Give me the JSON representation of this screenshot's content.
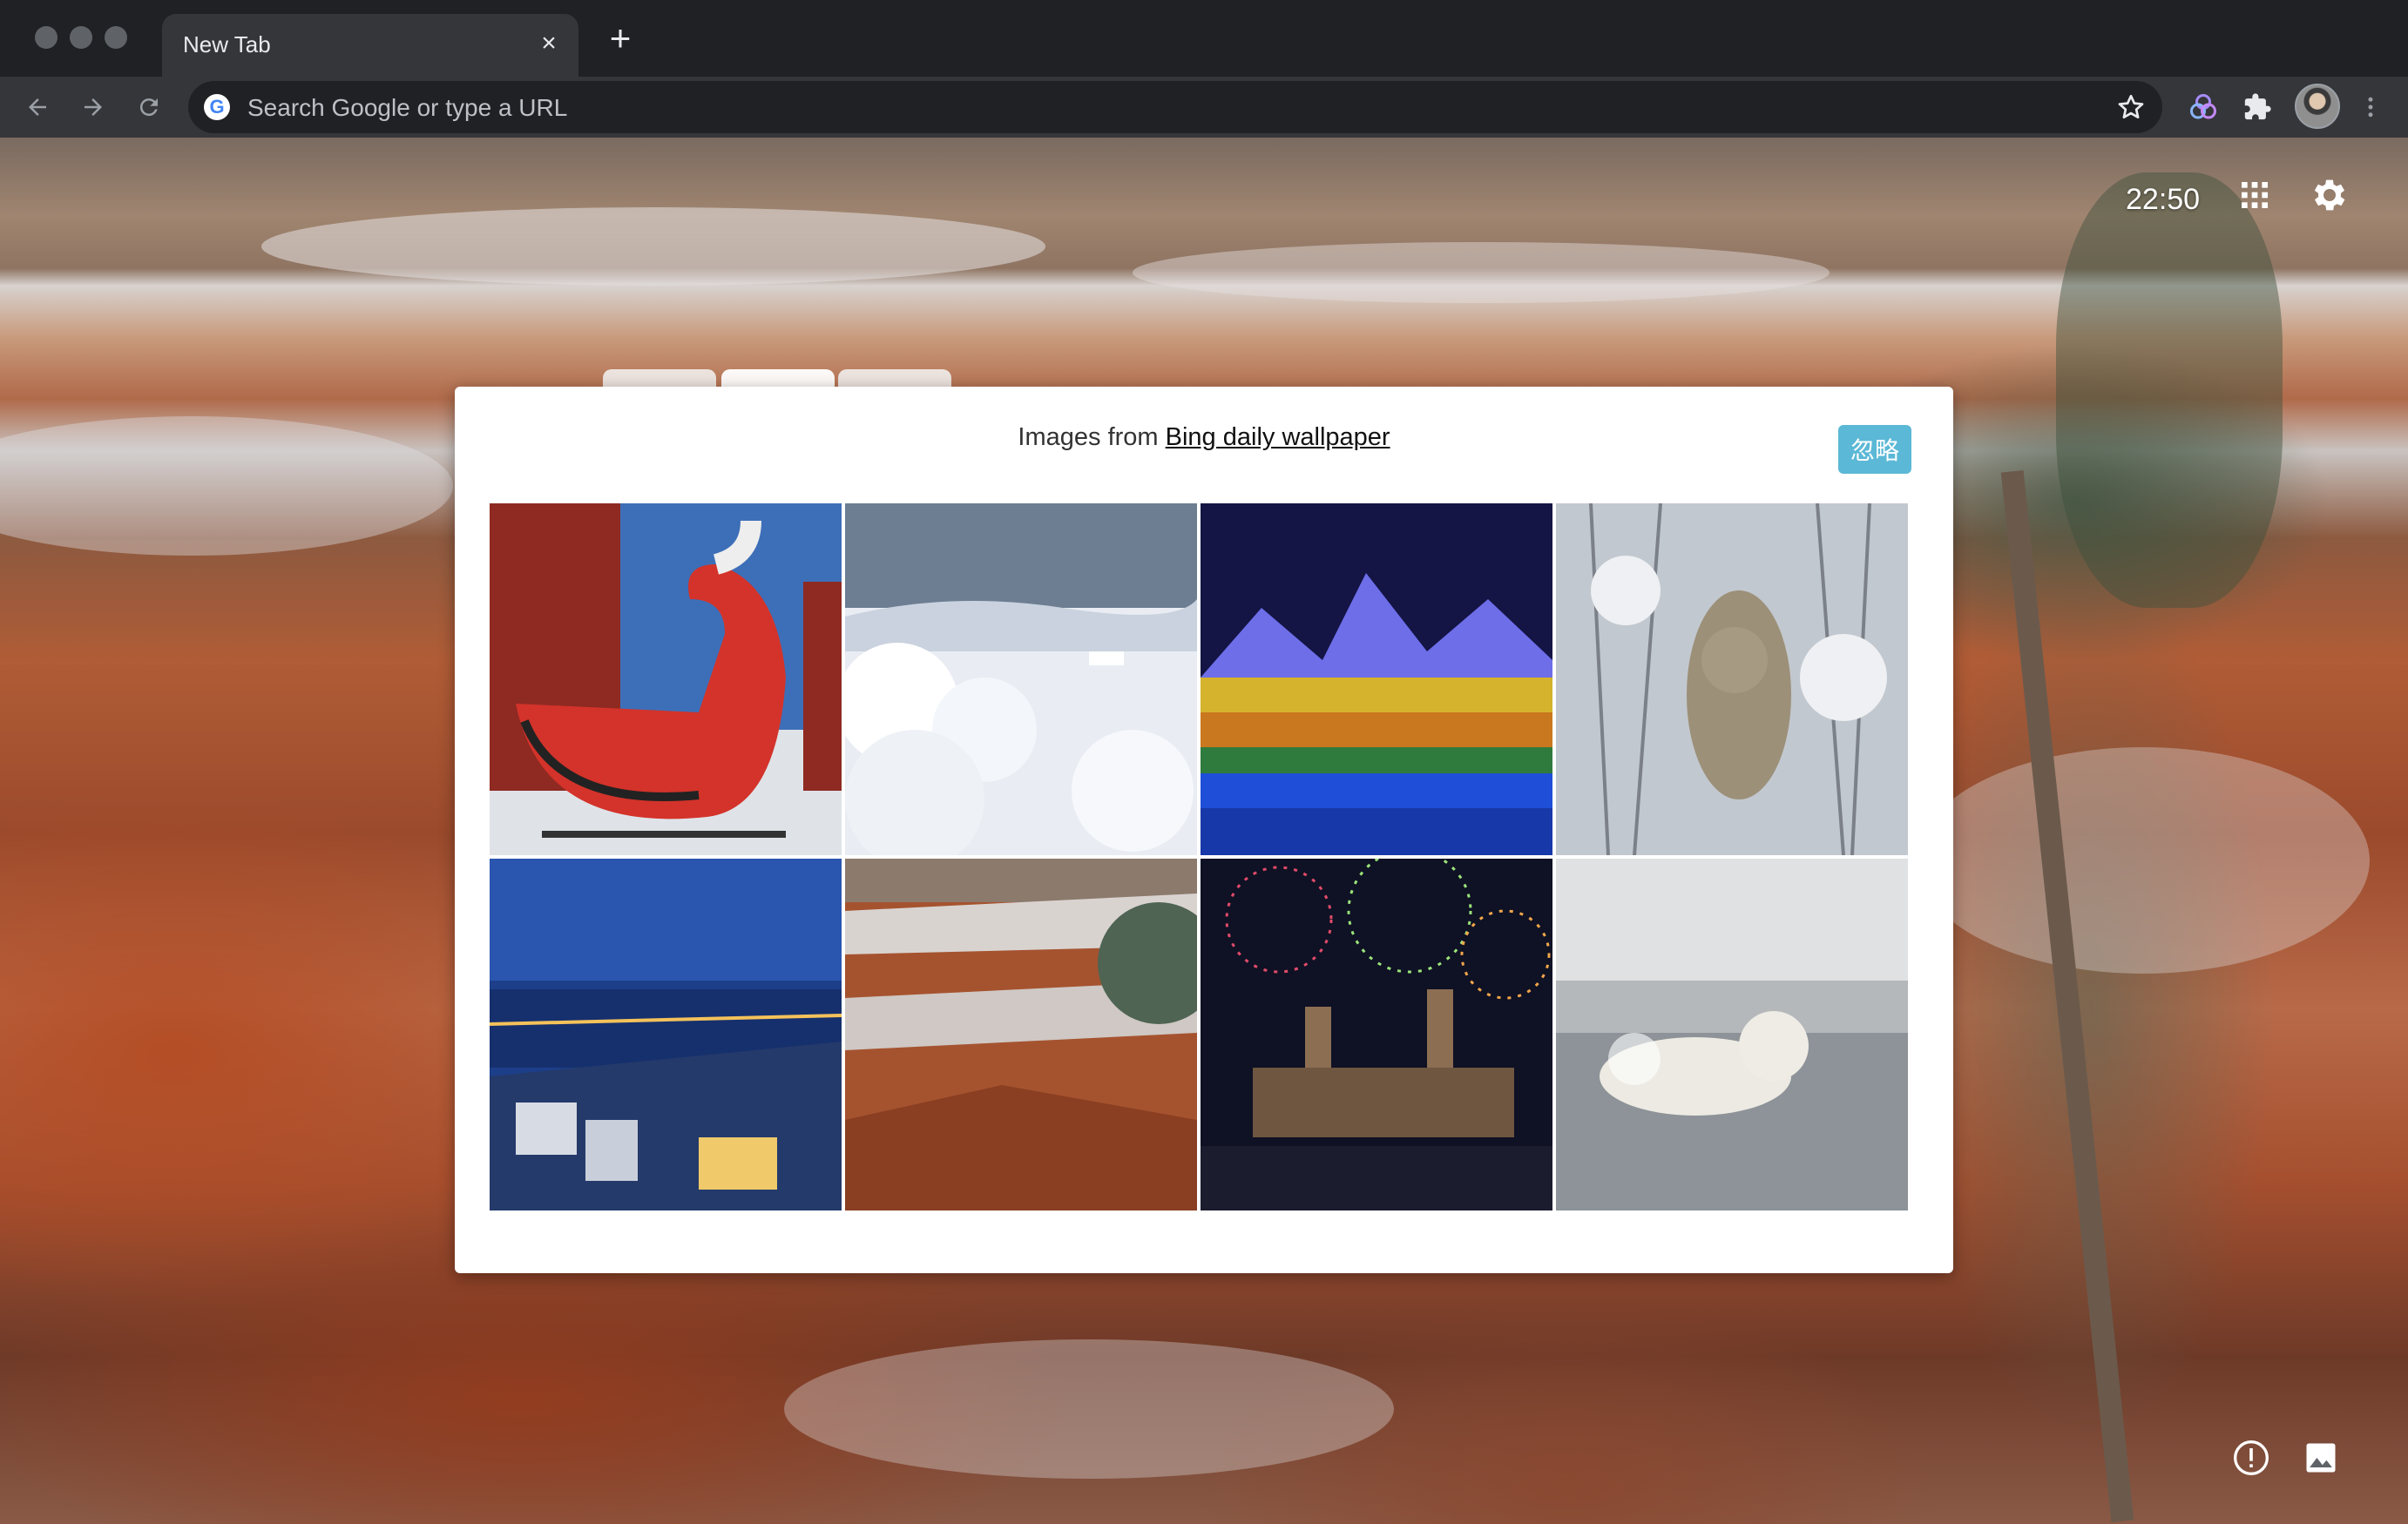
{
  "browser": {
    "tab": {
      "title": "New Tab"
    },
    "omnibox": {
      "placeholder": "Search Google or type a URL",
      "engine_logo": "G"
    }
  },
  "page": {
    "clock": "22:50",
    "panel": {
      "header_prefix": "Images from",
      "header_link": "Bing daily wallpaper",
      "ignore_button": "忽略",
      "images": [
        {
          "subject": "red sleigh"
        },
        {
          "subject": "snowy forest"
        },
        {
          "subject": "light festival"
        },
        {
          "subject": "lynx in snow"
        },
        {
          "subject": "lakeside city at night"
        },
        {
          "subject": "snowy canyon"
        },
        {
          "subject": "fireworks over cathedral"
        },
        {
          "subject": "polar bear in water"
        }
      ]
    }
  },
  "colors": {
    "chrome_dark": "#202124",
    "toolbar": "#35363a",
    "ignore_button": "#5bb8d6"
  }
}
